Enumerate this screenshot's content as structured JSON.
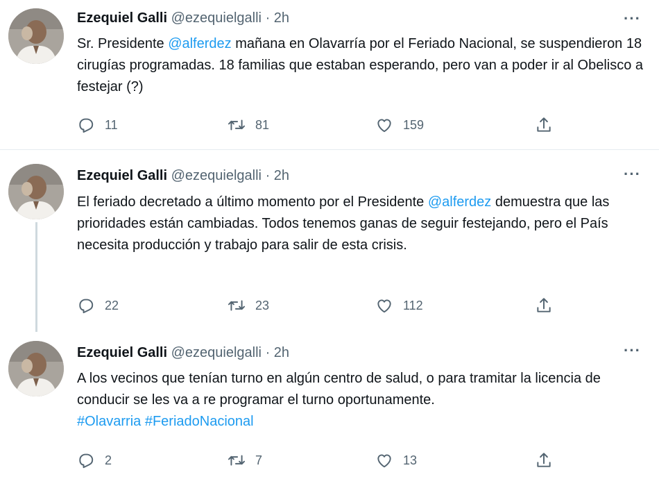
{
  "tweets": [
    {
      "name": "Ezequiel Galli",
      "handle": "@ezequielgalli",
      "sep": "·",
      "time": "2h",
      "text_before": "Sr. Presidente ",
      "mention": "@alferdez",
      "text_after": " mañana en Olavarría por el Feriado Nacional, se suspendieron 18 cirugías programadas. 18 familias que estaban esperando, pero van a poder ir al Obelisco a festejar (?)",
      "replies": "11",
      "retweets": "81",
      "likes": "159"
    },
    {
      "name": "Ezequiel Galli",
      "handle": "@ezequielgalli",
      "sep": "·",
      "time": "2h",
      "text_before": "El feriado decretado a último momento por el Presidente ",
      "mention": "@alferdez",
      "text_after": " demuestra que las prioridades están cambiadas. Todos tenemos ganas de seguir festejando, pero el País necesita producción y trabajo para salir de esta crisis.",
      "replies": "22",
      "retweets": "23",
      "likes": "112"
    },
    {
      "name": "Ezequiel Galli",
      "handle": "@ezequielgalli",
      "sep": "·",
      "time": "2h",
      "text_before": "A los vecinos que tenían turno en algún centro de salud, o para tramitar la licencia de conducir se les va a re programar el turno oportunamente.",
      "hashtag1": "#Olavarria",
      "hashtag2": "#FeriadoNacional",
      "replies": "2",
      "retweets": "7",
      "likes": "13"
    }
  ],
  "more_label": "···",
  "colors": {
    "link": "#1d9bf0",
    "muted": "#536471",
    "text": "#0f1419",
    "thread_line": "#cfd9de"
  },
  "icons": [
    "reply-icon",
    "retweet-icon",
    "like-icon",
    "share-icon",
    "more-icon",
    "avatar"
  ]
}
